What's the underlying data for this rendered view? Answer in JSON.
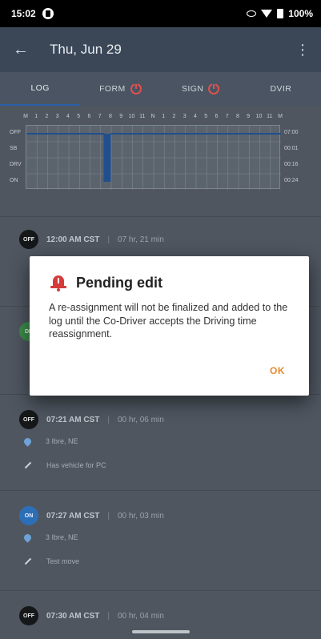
{
  "status_bar": {
    "time": "15:02",
    "battery": "100%"
  },
  "app_bar": {
    "back_icon": "arrow-back-icon",
    "title": "Thu, Jun 29",
    "more_icon": "more-vert-icon"
  },
  "tabs": [
    {
      "label": "LOG",
      "alert": false,
      "active": true
    },
    {
      "label": "FORM",
      "alert": true,
      "active": false
    },
    {
      "label": "SIGN",
      "alert": true,
      "active": false
    },
    {
      "label": "DVIR",
      "alert": false,
      "active": false
    }
  ],
  "log_grid": {
    "hours": [
      "M",
      "1",
      "2",
      "3",
      "4",
      "5",
      "6",
      "7",
      "8",
      "9",
      "10",
      "11",
      "N",
      "1",
      "2",
      "3",
      "4",
      "5",
      "6",
      "7",
      "8",
      "9",
      "10",
      "11",
      "M"
    ],
    "rows": [
      {
        "label": "OFF",
        "total": "07:00"
      },
      {
        "label": "SB",
        "total": "00:01"
      },
      {
        "label": "DRV",
        "total": "00:16"
      },
      {
        "label": "ON",
        "total": "00:24"
      }
    ]
  },
  "entries": [
    {
      "badge": "OFF",
      "time": "12:00 AM CST",
      "duration": "07 hr, 21 min",
      "location": "",
      "note": ""
    },
    {
      "badge": "DR",
      "time": "",
      "duration": "",
      "location": "",
      "note": ""
    },
    {
      "badge": "OFF",
      "time": "07:21 AM CST",
      "duration": "00 hr, 06 min",
      "location": "3 Ibre, NE",
      "note": "Has vehicle for PC"
    },
    {
      "badge": "ON",
      "time": "07:27 AM CST",
      "duration": "00 hr, 03 min",
      "location": "3 Ibre, NE",
      "note": "Test move"
    },
    {
      "badge": "OFF",
      "time": "07:30 AM CST",
      "duration": "00 hr, 04 min",
      "location": "",
      "note": ""
    }
  ],
  "dialog": {
    "icon": "alarm-bell-icon",
    "title": "Pending edit",
    "body": "A re-assignment will not be finalized and added to the log until the Co-Driver accepts the Driving time reassignment.",
    "ok_label": "OK"
  }
}
